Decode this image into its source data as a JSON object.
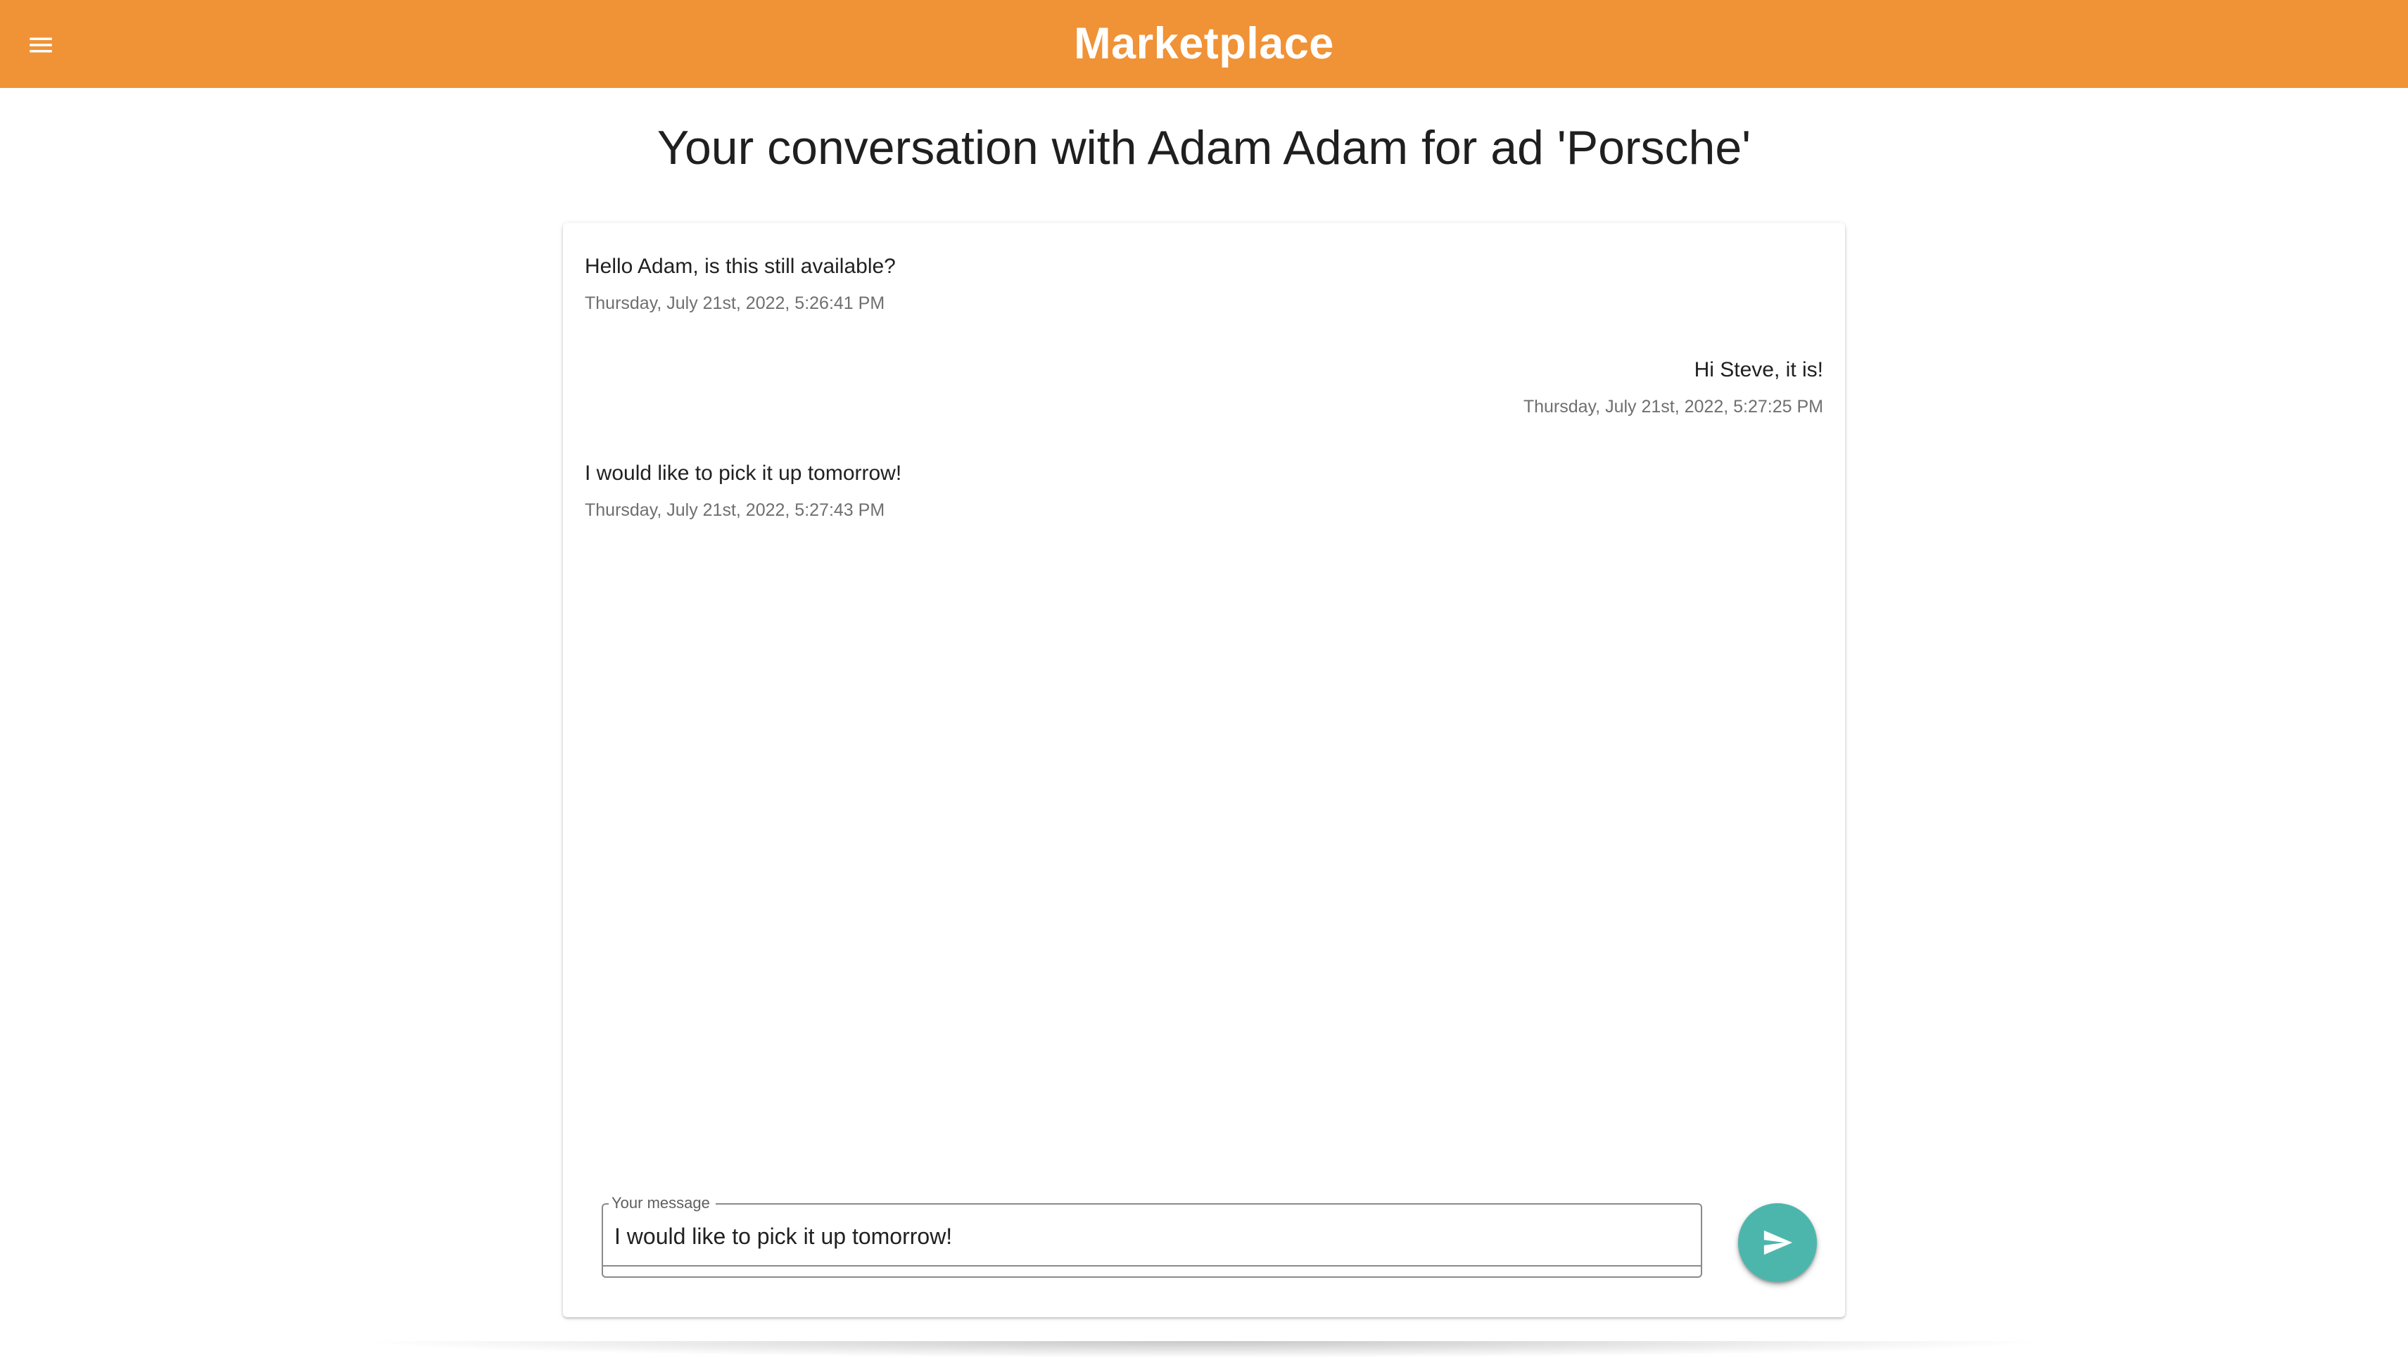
{
  "header": {
    "title": "Marketplace",
    "menu_icon": "menu-icon",
    "color": "#f09236"
  },
  "page": {
    "title": "Your conversation with Adam Adam for ad 'Porsche'"
  },
  "messages": [
    {
      "text": "Hello Adam, is this still available?",
      "timestamp": "Thursday, July 21st, 2022, 5:26:41 PM",
      "side": "left"
    },
    {
      "text": "Hi Steve, it is!",
      "timestamp": "Thursday, July 21st, 2022, 5:27:25 PM",
      "side": "right"
    },
    {
      "text": "I would like to pick it up tomorrow!",
      "timestamp": "Thursday, July 21st, 2022, 5:27:43 PM",
      "side": "left"
    }
  ],
  "composer": {
    "label": "Your message",
    "value": "I would like to pick it up tomorrow!",
    "send_icon": "send-icon",
    "send_color": "#4db6ac"
  }
}
